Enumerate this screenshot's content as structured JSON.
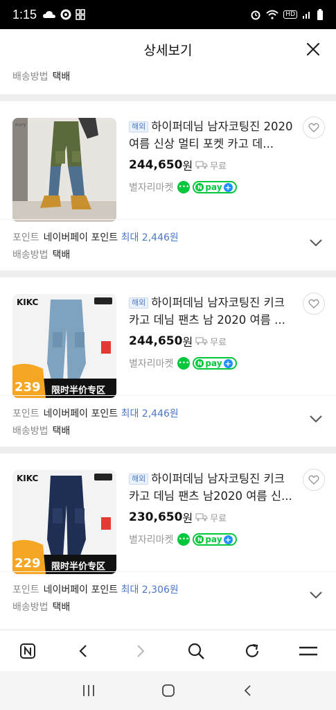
{
  "status": {
    "time": "1:15",
    "left_icons": [
      "weather-icon",
      "sync-icon",
      "grid-icon"
    ],
    "right_icons": [
      "alarm-icon",
      "wifi-icon",
      "hd-icon",
      "signal-icon",
      "battery-icon"
    ],
    "hd_label": "HD"
  },
  "header": {
    "title": "상세보기"
  },
  "top_meta": {
    "ship_label": "배송방법",
    "ship_value": "택배"
  },
  "products": [
    {
      "badge": "해외",
      "title": "하이퍼데님 남자코팅진 2020 여름 신상 멀티 포켓 카고 데...",
      "price": "244,650",
      "won": "원",
      "shipping": "무료",
      "seller": "별자리마켓",
      "npay": "pay",
      "point_label": "포인트",
      "point_value": "네이버페이 포인트",
      "point_max": "최대 2,446원",
      "ship_label": "배송방법",
      "ship_value": "택배",
      "thumb_type": "photo",
      "thumb_text": "eury"
    },
    {
      "badge": "해외",
      "title": "하이퍼데님 남자코팅진 키크 카고 데님 팬츠 남 2020 여름 ...",
      "price": "244,650",
      "won": "원",
      "shipping": "무료",
      "seller": "별자리마켓",
      "npay": "pay",
      "point_label": "포인트",
      "point_value": "네이버페이 포인트",
      "point_max": "최대 2,446원",
      "ship_label": "배송방법",
      "ship_value": "택배",
      "thumb_type": "promo",
      "thumb_brand": "KIKC",
      "thumb_price": "239",
      "thumb_promo": "限时半价专区",
      "pants_color": "#7fa2bf"
    },
    {
      "badge": "해외",
      "title": "하이퍼데님 남자코팅진 키크 카고 데님 팬츠 남2020 여름 신...",
      "price": "230,650",
      "won": "원",
      "shipping": "무료",
      "seller": "별자리마켓",
      "npay": "pay",
      "point_label": "포인트",
      "point_value": "네이버페이 포인트",
      "point_max": "최대 2,306원",
      "ship_label": "배송방법",
      "ship_value": "택배",
      "thumb_type": "promo",
      "thumb_brand": "KIKC",
      "thumb_price": "229",
      "thumb_promo": "限时半价专区",
      "pants_color": "#1f2f54"
    }
  ],
  "toolbar": [
    "naver-home-icon",
    "back-icon",
    "forward-icon",
    "search-icon",
    "reload-icon",
    "menu-icon"
  ],
  "navbar": [
    "recent-apps-icon",
    "home-icon",
    "back-icon"
  ],
  "colors": {
    "accent_blue": "#4a77c9",
    "npay_green": "#00c73c"
  }
}
